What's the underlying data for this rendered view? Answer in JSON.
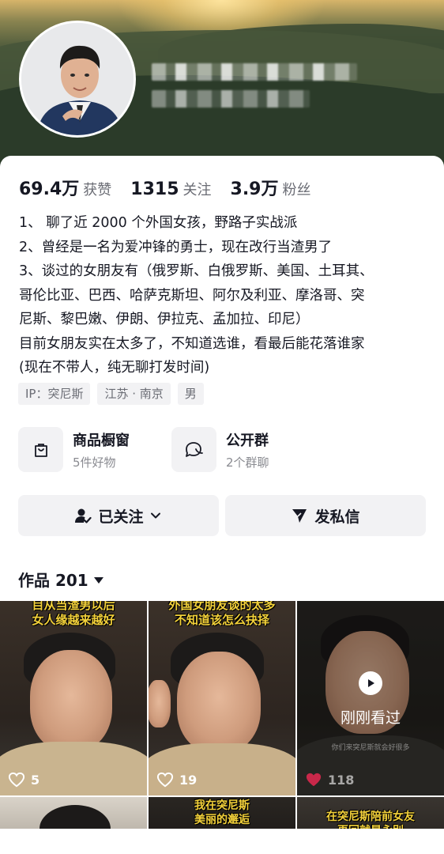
{
  "stats": [
    {
      "num": "69.4万",
      "label": "获赞"
    },
    {
      "num": "1315",
      "label": "关注"
    },
    {
      "num": "3.9万",
      "label": "粉丝"
    }
  ],
  "bio": [
    "1、 聊了近 2000 个外国女孩，野路子实战派",
    "2、曾经是一名为爱冲锋的勇士，现在改行当渣男了",
    "3、谈过的女朋友有（俄罗斯、白俄罗斯、美国、土耳其、",
    "哥伦比亚、巴西、哈萨克斯坦、阿尔及利亚、摩洛哥、突",
    "尼斯、黎巴嫩、伊朗、伊拉克、孟加拉、印尼）",
    "目前女朋友实在太多了，不知道选谁，看最后能花落谁家",
    "(现在不带人，纯无聊打发时间)"
  ],
  "tags": [
    "IP：突尼斯",
    "江苏 · 南京",
    "男"
  ],
  "shortcuts": [
    {
      "title": "商品橱窗",
      "sub": "5件好物",
      "icon": "shopping-bag-icon"
    },
    {
      "title": "公开群",
      "sub": "2个群聊",
      "icon": "group-chat-icon"
    }
  ],
  "actions": {
    "follow": "已关注",
    "message": "发私信"
  },
  "works": {
    "label": "作品 201"
  },
  "videos": [
    {
      "caption": "目从当渣男以后\n女人缘越来越好",
      "likes": "5"
    },
    {
      "caption": "外国女朋友谈的太多\n不知道该怎么抉择",
      "likes": "19"
    },
    {
      "caption": "",
      "likes": "118",
      "seen": "刚刚看过",
      "subtle": "你们来突尼斯就会好很多"
    },
    {
      "caption": "",
      "likes": ""
    },
    {
      "caption": "我在突尼斯\n美丽的邂逅",
      "likes": ""
    },
    {
      "caption": "在突尼斯陪前女友\n再回就是永别",
      "likes": ""
    }
  ],
  "colors": {
    "accent_caption": "#f3d13a",
    "liked_heart": "#fe2c55"
  }
}
